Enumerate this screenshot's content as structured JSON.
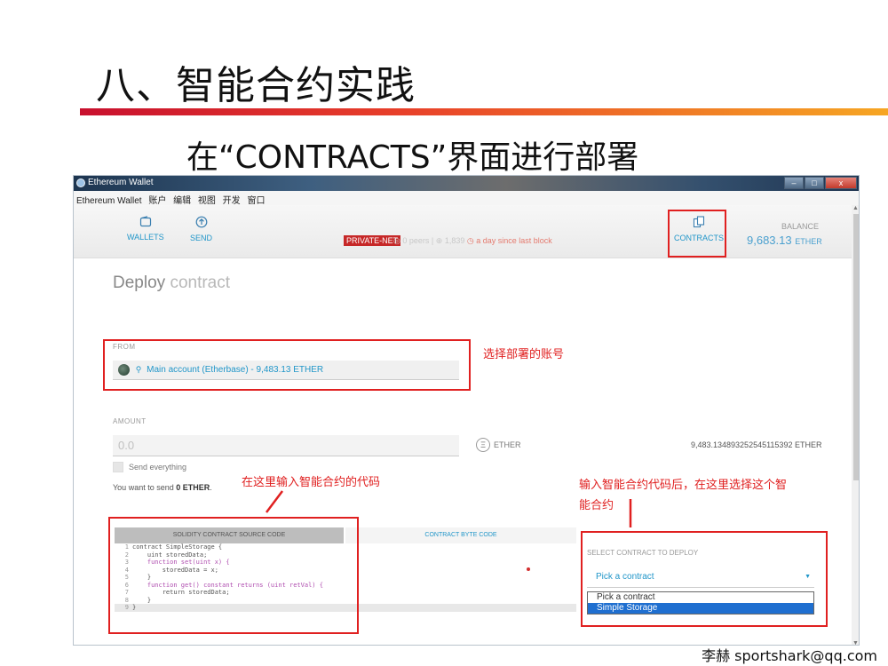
{
  "slide": {
    "title": "八、智能合约实践",
    "subtitle": "在“CONTRACTS”界面进行部署",
    "footer": "李赫 sportshark@qq.com",
    "accent_colors": [
      "#c8102e",
      "#f6a623"
    ]
  },
  "window": {
    "title": "Ethereum Wallet",
    "controls": [
      "–",
      "□",
      "x"
    ],
    "menu": [
      "Ethereum Wallet",
      "账户",
      "编辑",
      "视图",
      "开发",
      "窗口"
    ]
  },
  "nav": {
    "wallets": {
      "icon": "wallet-icon",
      "label": "WALLETS"
    },
    "send": {
      "icon": "send-icon",
      "label": "SEND"
    },
    "network_badge": "PRIVATE-NET",
    "peers": "0 peers",
    "block": "1,839",
    "last_block": "a day since last block",
    "contracts": {
      "icon": "contracts-icon",
      "label": "CONTRACTS"
    },
    "balance_label": "BALANCE",
    "balance_value": "9,683.13",
    "balance_unit": "ETHER"
  },
  "deploy": {
    "title_bold": "Deploy",
    "title_light": "contract",
    "from_label": "FROM",
    "from_value": "Main account (Etherbase) - 9,483.13 ETHER",
    "amount_label": "AMOUNT",
    "amount_placeholder": "0.0",
    "amount_unit": "ETHER",
    "amount_max": "9,483.134893252545115392 ETHER",
    "send_everything": "Send everything",
    "send_note_prefix": "You want to send",
    "send_note_amount": "0 ETHER",
    "send_note_suffix": ".",
    "tab_source": "SOLIDITY CONTRACT SOURCE CODE",
    "tab_bytecode": "CONTRACT BYTE CODE",
    "code_lines": [
      {
        "n": "1",
        "text": "contract SimpleStorage {"
      },
      {
        "n": "2",
        "text": "    uint storedData;"
      },
      {
        "n": "3",
        "text": "    function set(uint x) {"
      },
      {
        "n": "4",
        "text": "        storedData = x;"
      },
      {
        "n": "5",
        "text": "    }"
      },
      {
        "n": "6",
        "text": "    function get() constant returns (uint retVal) {"
      },
      {
        "n": "7",
        "text": "        return storedData;"
      },
      {
        "n": "8",
        "text": "    }"
      },
      {
        "n": "9",
        "text": "}"
      }
    ],
    "select_label": "SELECT CONTRACT TO DEPLOY",
    "select_value": "Pick a contract",
    "options": [
      "Pick a contract",
      "Simple Storage"
    ],
    "selected_option": "Simple Storage"
  },
  "annotations": {
    "from_note": "选择部署的账号",
    "code_note": "在这里输入智能合约的代码",
    "select_note_line1": "输入智能合约代码后，在这里选择这个智",
    "select_note_line2": "能合约"
  }
}
